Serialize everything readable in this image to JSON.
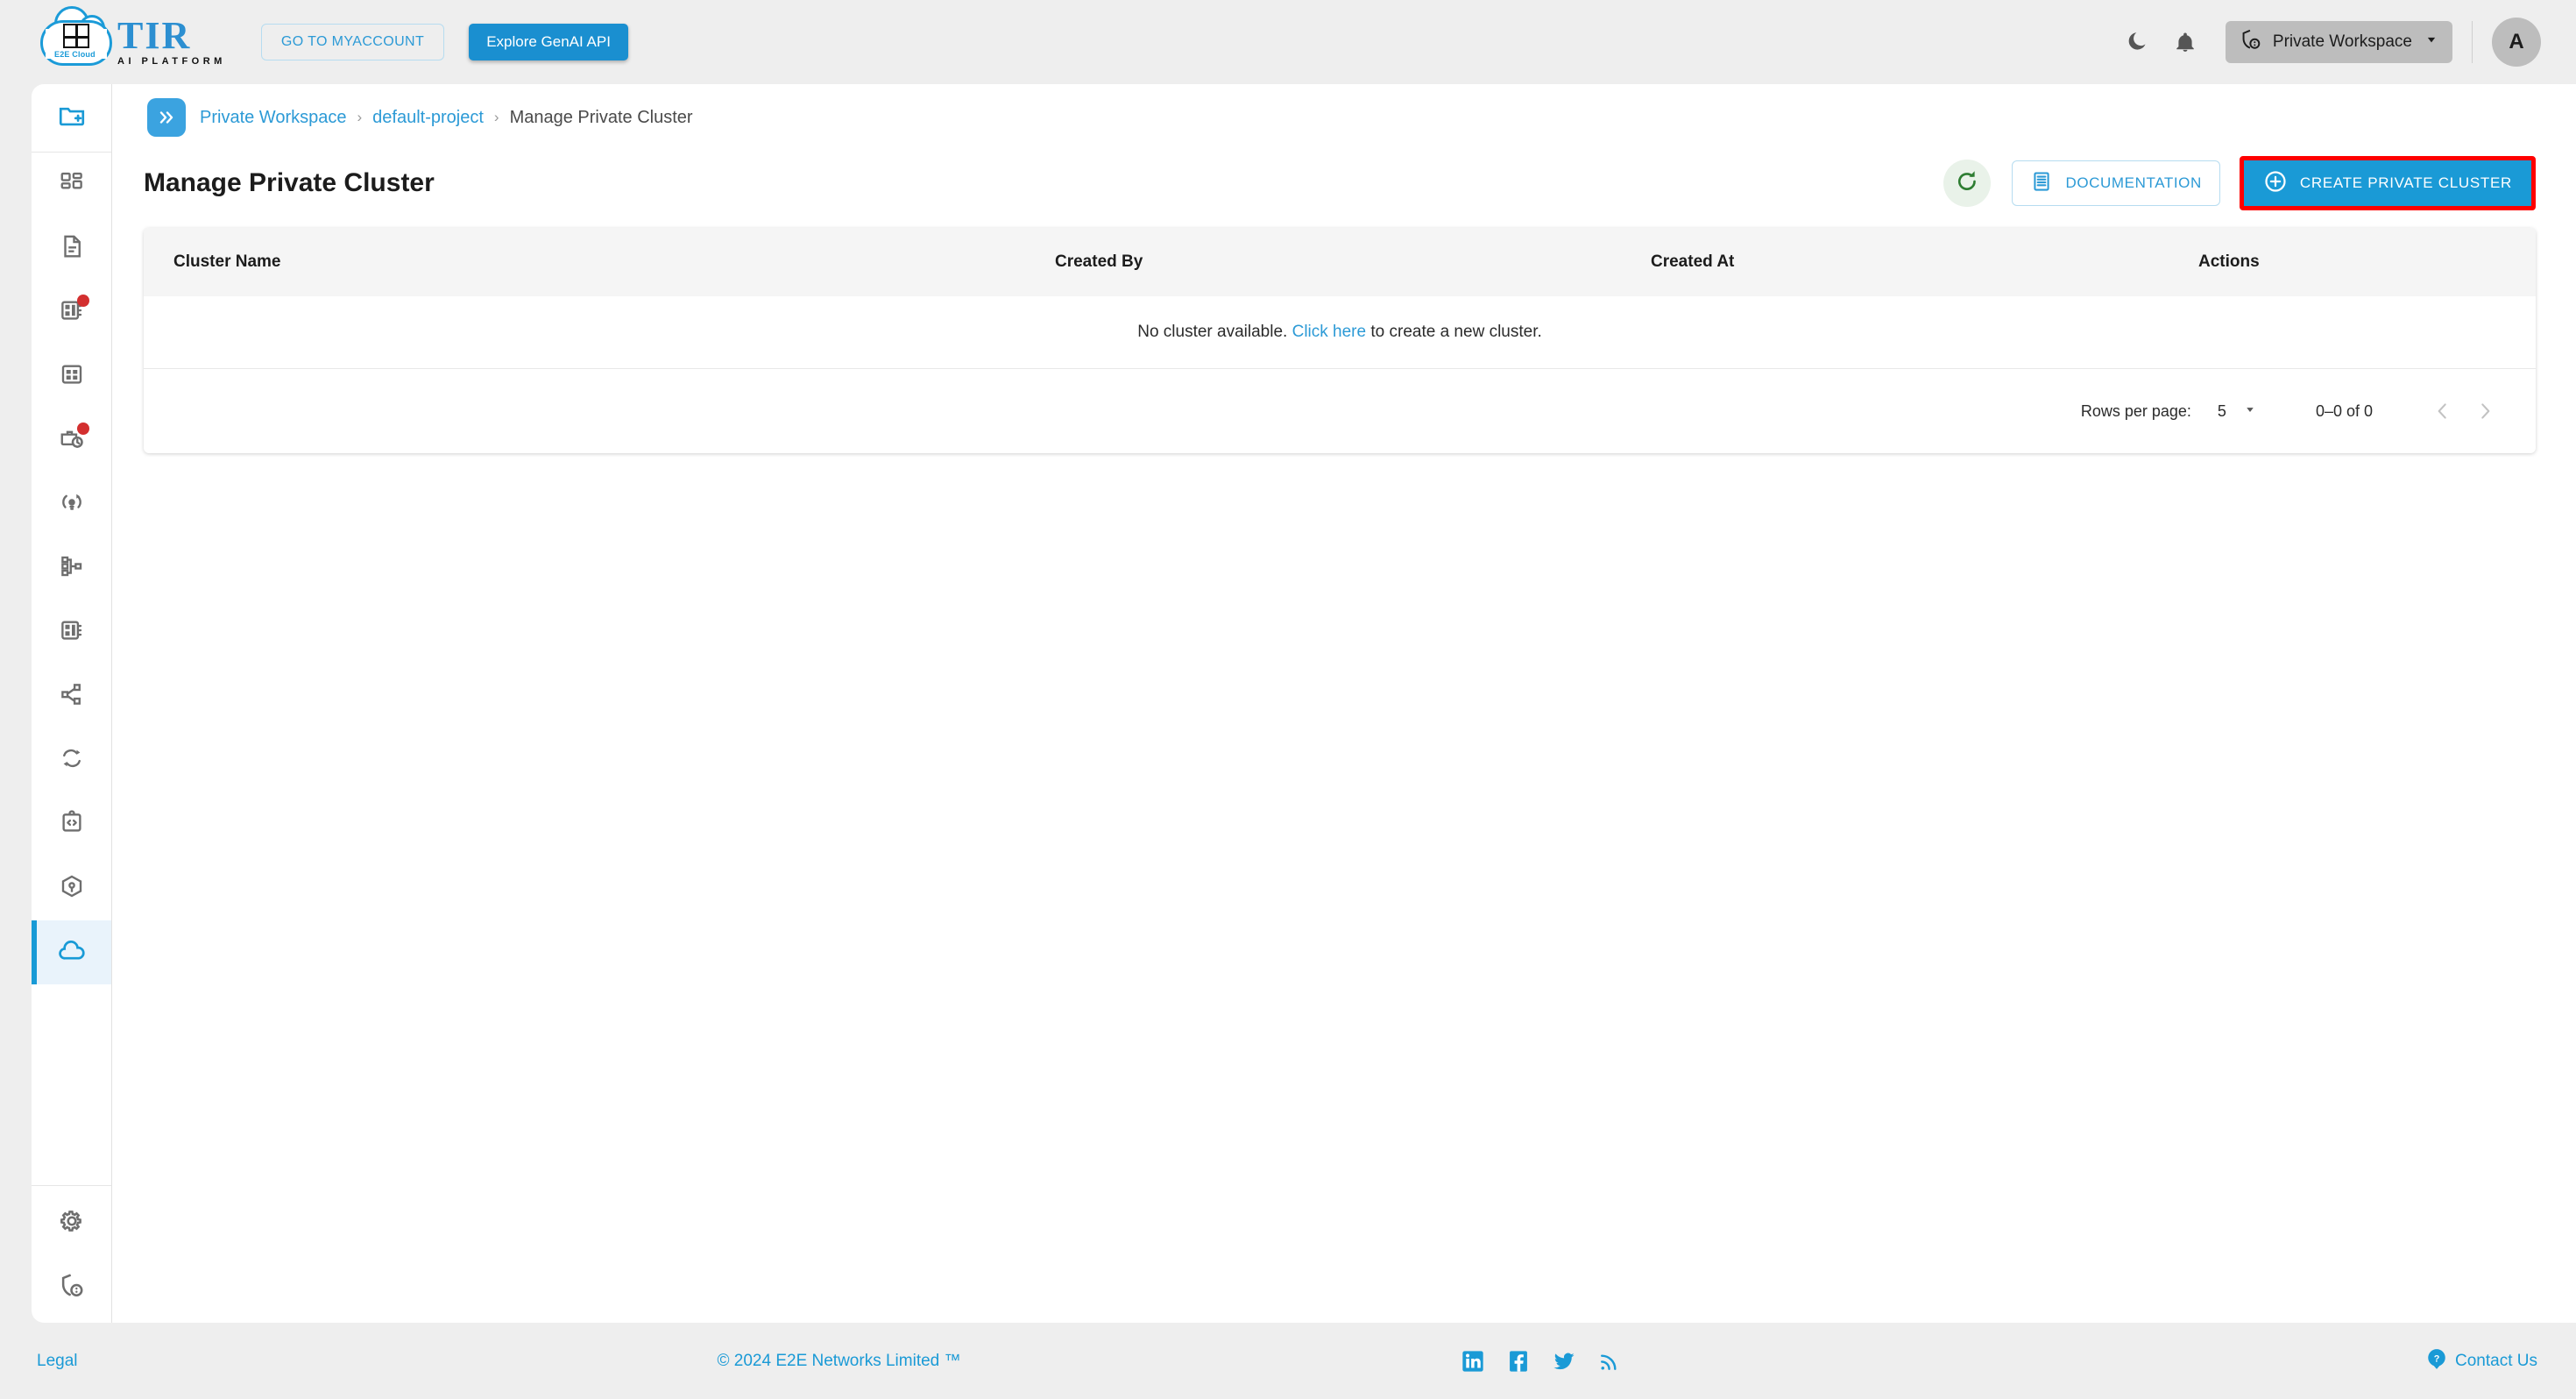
{
  "header": {
    "logo": {
      "brand": "TIR",
      "subtitle": "AI PLATFORM",
      "badge": "E2E Cloud"
    },
    "myaccount_label": "GO TO MYACCOUNT",
    "genai_label": "Explore GenAI API",
    "dark_mode_icon": "moon-icon",
    "notifications_icon": "bell-icon",
    "workspace_label": "Private Workspace",
    "workspace_icon": "shield-user-icon",
    "avatar_initial": "A"
  },
  "breadcrumb": {
    "collapse_icon": "double-chevron-right-icon",
    "items": [
      {
        "label": "Private Workspace",
        "link": true
      },
      {
        "label": "default-project",
        "link": true
      },
      {
        "label": "Manage Private Cluster",
        "link": false
      }
    ],
    "separator": "›"
  },
  "page": {
    "title": "Manage Private Cluster",
    "refresh_icon": "refresh-icon",
    "documentation_label": "DOCUMENTATION",
    "documentation_icon": "document-icon",
    "create_label": "CREATE PRIVATE CLUSTER",
    "create_icon": "plus-circle-icon"
  },
  "table": {
    "columns": [
      "Cluster Name",
      "Created By",
      "Created At",
      "Actions"
    ],
    "rows": [],
    "empty_prefix": "No cluster available.",
    "empty_link": "Click here",
    "empty_suffix": "to create a new cluster."
  },
  "pagination": {
    "rows_per_page_label": "Rows per page:",
    "rows_per_page_value": "5",
    "range_label": "0–0 of 0",
    "prev_icon": "chevron-left-icon",
    "next_icon": "chevron-right-icon"
  },
  "sidebar": {
    "items": [
      {
        "name": "new-project",
        "icon": "folder-plus-icon",
        "badge": false,
        "active": false
      },
      {
        "name": "dashboard",
        "icon": "dashboard-grid-icon",
        "badge": false,
        "active": false
      },
      {
        "name": "notebooks",
        "icon": "document-icon",
        "badge": false,
        "active": false
      },
      {
        "name": "gpu-nodes",
        "icon": "chip-badge-icon",
        "badge": true,
        "active": false
      },
      {
        "name": "datasets",
        "icon": "grid-square-icon",
        "badge": false,
        "active": false
      },
      {
        "name": "jobs",
        "icon": "briefcase-clock-icon",
        "badge": true,
        "active": false
      },
      {
        "name": "finetuning",
        "icon": "bulb-refresh-icon",
        "badge": false,
        "active": false
      },
      {
        "name": "pipelines",
        "icon": "hierarchy-icon",
        "badge": false,
        "active": false
      },
      {
        "name": "inference",
        "icon": "chip-icon",
        "badge": false,
        "active": false
      },
      {
        "name": "model-endpoints",
        "icon": "share-nodes-icon",
        "badge": false,
        "active": false
      },
      {
        "name": "sync",
        "icon": "sync-icon",
        "badge": false,
        "active": false
      },
      {
        "name": "api-tokens",
        "icon": "clipboard-code-icon",
        "badge": false,
        "active": false
      },
      {
        "name": "models",
        "icon": "cube-icon",
        "badge": false,
        "active": false
      },
      {
        "name": "private-cluster",
        "icon": "cloud-icon",
        "badge": false,
        "active": true
      }
    ],
    "bottom_items": [
      {
        "name": "settings",
        "icon": "gear-icon"
      },
      {
        "name": "security",
        "icon": "shield-user-icon"
      }
    ]
  },
  "footer": {
    "legal": "Legal",
    "copyright": "© 2024 E2E Networks Limited ™",
    "social": [
      "linkedin-icon",
      "facebook-icon",
      "twitter-icon",
      "rss-icon"
    ],
    "contact_label": "Contact Us",
    "contact_icon": "help-icon"
  },
  "colors": {
    "accent": "#1a9ad6",
    "highlight": "#ff0000",
    "badge": "#d32f2f",
    "refresh": "#2e7d32",
    "page_bg": "#eeeeee"
  }
}
